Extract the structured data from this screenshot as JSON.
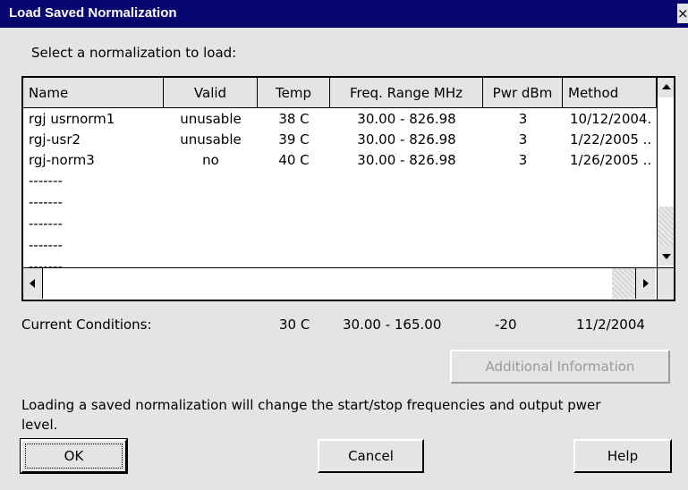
{
  "window": {
    "title": "Load Saved Normalization",
    "close_glyph": "×"
  },
  "prompt": "Select a normalization to load:",
  "table": {
    "columns": [
      "Name",
      "Valid",
      "Temp",
      "Freq. Range MHz",
      "Pwr dBm",
      "Method"
    ],
    "rows": [
      [
        "rgj usrnorm1",
        "unusable",
        "38 C",
        "30.00 - 826.98",
        "3",
        "10/12/2004."
      ],
      [
        "rgj-usr2",
        "unusable",
        "39 C",
        "30.00 - 826.98",
        "3",
        "1/22/2005  .."
      ],
      [
        "rgj-norm3",
        "no",
        "40 C",
        "30.00 - 826.98",
        "3",
        "1/26/2005  .."
      ],
      [
        "-------",
        "",
        "",
        "",
        "",
        ""
      ],
      [
        "-------",
        "",
        "",
        "",
        "",
        ""
      ],
      [
        "-------",
        "",
        "",
        "",
        "",
        ""
      ],
      [
        "-------",
        "",
        "",
        "",
        "",
        ""
      ],
      [
        "-------",
        "",
        "",
        "",
        "",
        ""
      ]
    ]
  },
  "current": {
    "label": "Current Conditions:",
    "temp": "30 C",
    "freq": "30.00 - 165.00",
    "pwr": "-20",
    "date": "11/2/2004"
  },
  "buttons": {
    "additional_info": "Additional Information",
    "ok": "OK",
    "cancel": "Cancel",
    "help": "Help"
  },
  "notice": {
    "line1": "Loading a saved normalization will change the start/stop frequencies and output pwer",
    "line2": "level."
  },
  "icons": {
    "up": "scroll-up-arrow-icon",
    "down": "scroll-down-arrow-icon",
    "left": "scroll-left-arrow-icon",
    "right": "scroll-right-arrow-icon"
  }
}
